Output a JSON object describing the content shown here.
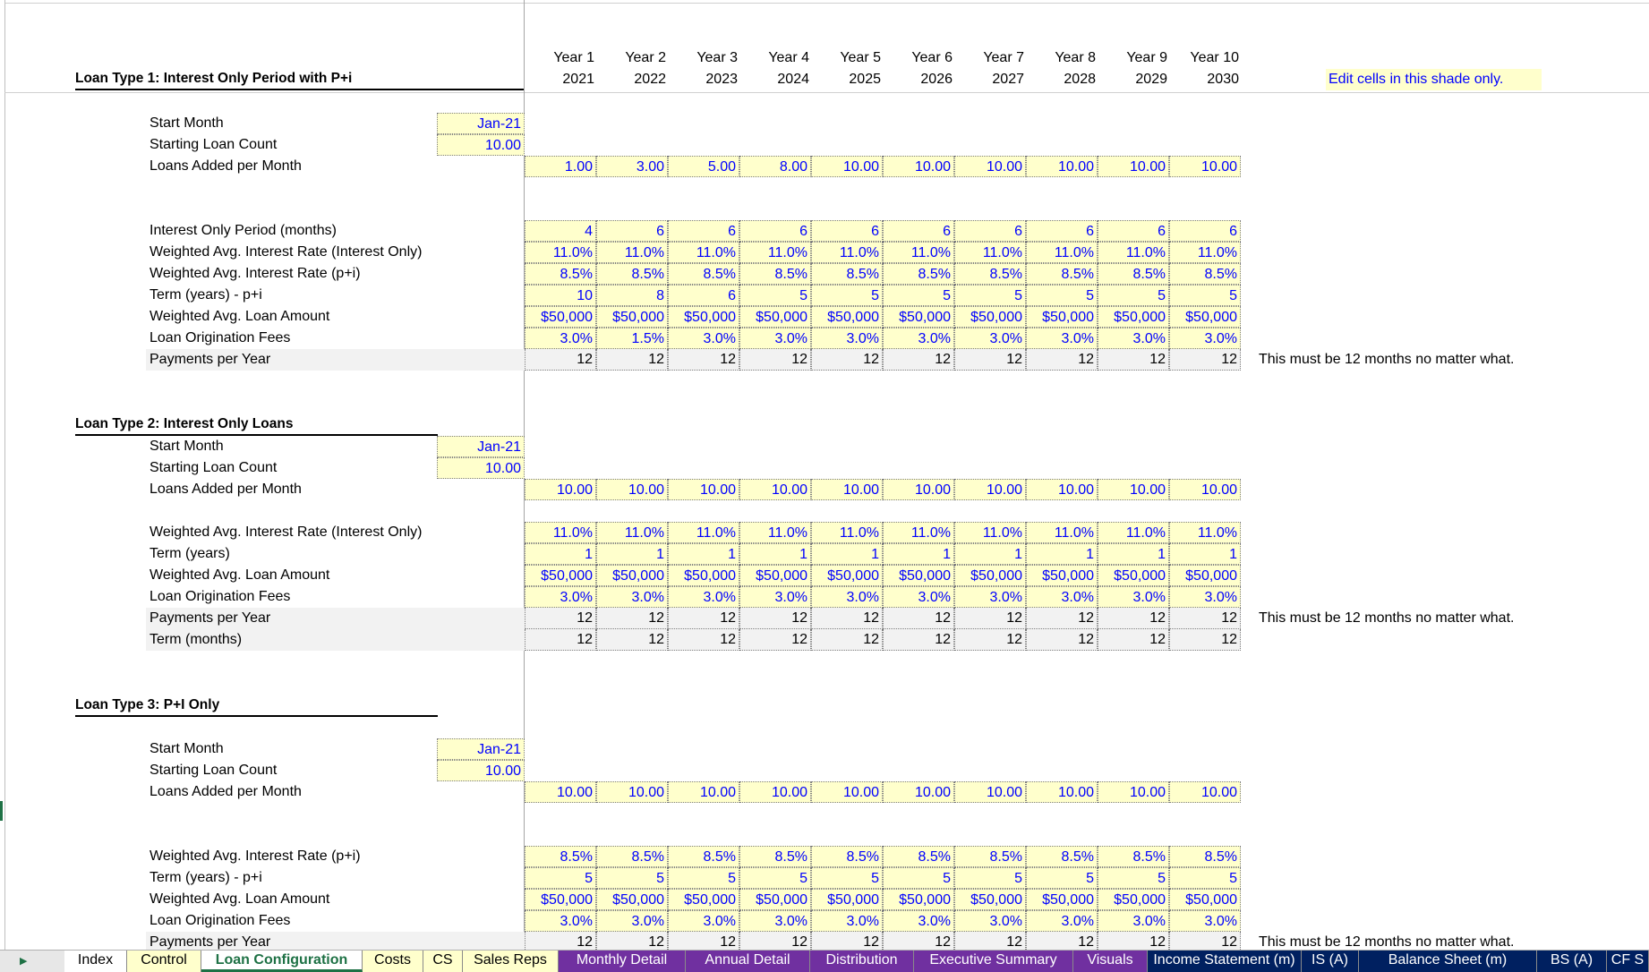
{
  "header": {
    "years": [
      "Year 1",
      "Year 2",
      "Year 3",
      "Year 4",
      "Year 5",
      "Year 6",
      "Year 7",
      "Year 8",
      "Year 9",
      "Year 10"
    ],
    "calendar_years": [
      "2021",
      "2022",
      "2023",
      "2024",
      "2025",
      "2026",
      "2027",
      "2028",
      "2029",
      "2030"
    ],
    "edit_note": "Edit cells in this shade only."
  },
  "payments_note": "This must be 12 months no matter what.",
  "loan_type_1": {
    "title": "Loan Type 1: Interest Only Period with P+i",
    "start_month": {
      "label": "Start Month",
      "value": "Jan-21"
    },
    "starting_loan_count": {
      "label": "Starting Loan Count",
      "value": "10.00"
    },
    "loans_added": {
      "label": "Loans Added per Month",
      "values": [
        "1.00",
        "3.00",
        "5.00",
        "8.00",
        "10.00",
        "10.00",
        "10.00",
        "10.00",
        "10.00",
        "10.00"
      ]
    },
    "interest_only_period": {
      "label": "Interest Only Period (months)",
      "values": [
        "4",
        "6",
        "6",
        "6",
        "6",
        "6",
        "6",
        "6",
        "6",
        "6"
      ]
    },
    "rate_io": {
      "label": "Weighted Avg. Interest Rate (Interest Only)",
      "values": [
        "11.0%",
        "11.0%",
        "11.0%",
        "11.0%",
        "11.0%",
        "11.0%",
        "11.0%",
        "11.0%",
        "11.0%",
        "11.0%"
      ]
    },
    "rate_pi": {
      "label": "Weighted Avg. Interest Rate (p+i)",
      "values": [
        "8.5%",
        "8.5%",
        "8.5%",
        "8.5%",
        "8.5%",
        "8.5%",
        "8.5%",
        "8.5%",
        "8.5%",
        "8.5%"
      ]
    },
    "term": {
      "label": "Term (years) - p+i",
      "values": [
        "10",
        "8",
        "6",
        "5",
        "5",
        "5",
        "5",
        "5",
        "5",
        "5"
      ]
    },
    "loan_amount": {
      "label": "Weighted Avg. Loan Amount",
      "values": [
        "$50,000",
        "$50,000",
        "$50,000",
        "$50,000",
        "$50,000",
        "$50,000",
        "$50,000",
        "$50,000",
        "$50,000",
        "$50,000"
      ]
    },
    "fees": {
      "label": "Loan Origination Fees",
      "values": [
        "3.0%",
        "1.5%",
        "3.0%",
        "3.0%",
        "3.0%",
        "3.0%",
        "3.0%",
        "3.0%",
        "3.0%",
        "3.0%"
      ]
    },
    "payments": {
      "label": "Payments per Year",
      "values": [
        "12",
        "12",
        "12",
        "12",
        "12",
        "12",
        "12",
        "12",
        "12",
        "12"
      ]
    }
  },
  "loan_type_2": {
    "title": "Loan Type 2: Interest Only Loans",
    "start_month": {
      "label": "Start Month",
      "value": "Jan-21"
    },
    "starting_loan_count": {
      "label": "Starting Loan Count",
      "value": "10.00"
    },
    "loans_added": {
      "label": "Loans Added per Month",
      "values": [
        "10.00",
        "10.00",
        "10.00",
        "10.00",
        "10.00",
        "10.00",
        "10.00",
        "10.00",
        "10.00",
        "10.00"
      ]
    },
    "rate_io": {
      "label": "Weighted Avg. Interest Rate (Interest Only)",
      "values": [
        "11.0%",
        "11.0%",
        "11.0%",
        "11.0%",
        "11.0%",
        "11.0%",
        "11.0%",
        "11.0%",
        "11.0%",
        "11.0%"
      ]
    },
    "term": {
      "label": "Term (years)",
      "values": [
        "1",
        "1",
        "1",
        "1",
        "1",
        "1",
        "1",
        "1",
        "1",
        "1"
      ]
    },
    "loan_amount": {
      "label": "Weighted Avg. Loan Amount",
      "values": [
        "$50,000",
        "$50,000",
        "$50,000",
        "$50,000",
        "$50,000",
        "$50,000",
        "$50,000",
        "$50,000",
        "$50,000",
        "$50,000"
      ]
    },
    "fees": {
      "label": "Loan Origination Fees",
      "values": [
        "3.0%",
        "3.0%",
        "3.0%",
        "3.0%",
        "3.0%",
        "3.0%",
        "3.0%",
        "3.0%",
        "3.0%",
        "3.0%"
      ]
    },
    "payments": {
      "label": "Payments per Year",
      "values": [
        "12",
        "12",
        "12",
        "12",
        "12",
        "12",
        "12",
        "12",
        "12",
        "12"
      ]
    },
    "term_months": {
      "label": "Term (months)",
      "values": [
        "12",
        "12",
        "12",
        "12",
        "12",
        "12",
        "12",
        "12",
        "12",
        "12"
      ]
    }
  },
  "loan_type_3": {
    "title": "Loan Type 3: P+I Only",
    "start_month": {
      "label": "Start Month",
      "value": "Jan-21"
    },
    "starting_loan_count": {
      "label": "Starting Loan Count",
      "value": "10.00"
    },
    "loans_added": {
      "label": "Loans Added per Month",
      "values": [
        "10.00",
        "10.00",
        "10.00",
        "10.00",
        "10.00",
        "10.00",
        "10.00",
        "10.00",
        "10.00",
        "10.00"
      ]
    },
    "rate_pi": {
      "label": "Weighted Avg. Interest Rate (p+i)",
      "values": [
        "8.5%",
        "8.5%",
        "8.5%",
        "8.5%",
        "8.5%",
        "8.5%",
        "8.5%",
        "8.5%",
        "8.5%",
        "8.5%"
      ]
    },
    "term": {
      "label": "Term (years) - p+i",
      "values": [
        "5",
        "5",
        "5",
        "5",
        "5",
        "5",
        "5",
        "5",
        "5",
        "5"
      ]
    },
    "loan_amount": {
      "label": "Weighted Avg. Loan Amount",
      "values": [
        "$50,000",
        "$50,000",
        "$50,000",
        "$50,000",
        "$50,000",
        "$50,000",
        "$50,000",
        "$50,000",
        "$50,000",
        "$50,000"
      ]
    },
    "fees": {
      "label": "Loan Origination Fees",
      "values": [
        "3.0%",
        "3.0%",
        "3.0%",
        "3.0%",
        "3.0%",
        "3.0%",
        "3.0%",
        "3.0%",
        "3.0%",
        "3.0%"
      ]
    },
    "payments": {
      "label": "Payments per Year",
      "values": [
        "12",
        "12",
        "12",
        "12",
        "12",
        "12",
        "12",
        "12",
        "12",
        "12"
      ]
    }
  },
  "tabs": [
    {
      "label": "Index",
      "bg": "#ffffff",
      "fg": "#000000",
      "active": false
    },
    {
      "label": "Control",
      "bg": "#ffffcc",
      "fg": "#000000",
      "active": false
    },
    {
      "label": "Loan Configuration",
      "bg": "#ffffff",
      "fg": "#1e7145",
      "active": true
    },
    {
      "label": "Costs",
      "bg": "#ffffcc",
      "fg": "#000000",
      "active": false
    },
    {
      "label": "CS",
      "bg": "#ffffcc",
      "fg": "#000000",
      "active": false
    },
    {
      "label": "Sales Reps",
      "bg": "#ffffcc",
      "fg": "#000000",
      "active": false
    },
    {
      "label": "Monthly Detail",
      "bg": "#7030a0",
      "fg": "#ffffff",
      "active": false
    },
    {
      "label": "Annual Detail",
      "bg": "#7030a0",
      "fg": "#ffffff",
      "active": false
    },
    {
      "label": "Distribution",
      "bg": "#7030a0",
      "fg": "#ffffff",
      "active": false
    },
    {
      "label": "Executive Summary",
      "bg": "#7030a0",
      "fg": "#ffffff",
      "active": false
    },
    {
      "label": "Visuals",
      "bg": "#7030a0",
      "fg": "#ffffff",
      "active": false
    },
    {
      "label": "Income Statement (m)",
      "bg": "#002060",
      "fg": "#ffffff",
      "active": false
    },
    {
      "label": "IS (A)",
      "bg": "#002060",
      "fg": "#ffffff",
      "active": false
    },
    {
      "label": "Balance Sheet (m)",
      "bg": "#002060",
      "fg": "#ffffff",
      "active": false
    },
    {
      "label": "BS (A)",
      "bg": "#002060",
      "fg": "#ffffff",
      "active": false
    },
    {
      "label": "CF S",
      "bg": "#002060",
      "fg": "#ffffff",
      "active": false
    }
  ],
  "colors": {
    "input_fill": "#ffffcc",
    "input_text": "#0000ff",
    "readonly_fill": "#f2f2f2",
    "active_tab_text": "#1e7145"
  }
}
